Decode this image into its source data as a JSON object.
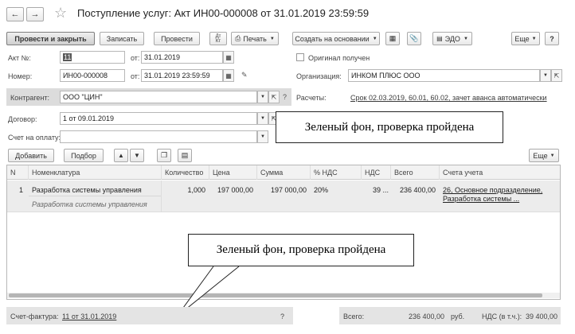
{
  "window": {
    "title": "Поступление услуг: Акт ИН00-000008 от 31.01.2019 23:59:59"
  },
  "toolbar": {
    "post_close": "Провести и закрыть",
    "save": "Записать",
    "post": "Провести",
    "dtkt_top": "Дт",
    "dtkt_bottom": "Кт",
    "print": "Печать",
    "create_based": "Создать на основании",
    "edo": "ЭДО",
    "more": "Еще",
    "help": "?"
  },
  "form": {
    "act_label": "Акт №:",
    "act_value": "11",
    "from_label": "от:",
    "act_date": "31.01.2019",
    "original_label": "Оригинал получен",
    "number_label": "Номер:",
    "number_value": "ИН00-000008",
    "number_datetime": "31.01.2019 23:59:59",
    "org_label": "Организация:",
    "org_value": "ИНКОМ ПЛЮС ООО",
    "counterparty_label": "Контрагент:",
    "counterparty_value": "ООО \"ЦИН\"",
    "settlements_label": "Расчеты:",
    "settlements_link": "Срок 02.03.2019, 60.01, 60.02, зачет аванса автоматически",
    "contract_label": "Договор:",
    "contract_value": "1 от 09.01.2019",
    "invoice_label": "Счет на оплату:",
    "invoice_value": ""
  },
  "table_toolbar": {
    "add": "Добавить",
    "select": "Подбор",
    "more": "Еще"
  },
  "table": {
    "headers": [
      "N",
      "Номенклатура",
      "Количество",
      "Цена",
      "Сумма",
      "% НДС",
      "НДС",
      "Всего",
      "Счета учета"
    ],
    "rows": [
      {
        "n": "1",
        "name": "Разработка системы управления",
        "name_sub": "Разработка системы управления",
        "qty": "1,000",
        "price": "197 000,00",
        "sum": "197 000,00",
        "vat_rate": "20%",
        "vat": "39 ...",
        "total": "236 400,00",
        "accounts_line1": "26, Основное подразделение,",
        "accounts_line2": "Разработка системы ..."
      }
    ]
  },
  "footer": {
    "sf_label": "Счет-фактура:",
    "sf_link": "11 от 31.01.2019",
    "sf_help": "?",
    "total_label": "Всего:",
    "total_value": "236 400,00",
    "currency": "руб.",
    "vat_label": "НДС (в т.ч.):",
    "vat_value": "39 400,00"
  },
  "callouts": {
    "top": "Зеленый фон, проверка пройдена",
    "bottom": "Зеленый фон, проверка пройдена"
  }
}
